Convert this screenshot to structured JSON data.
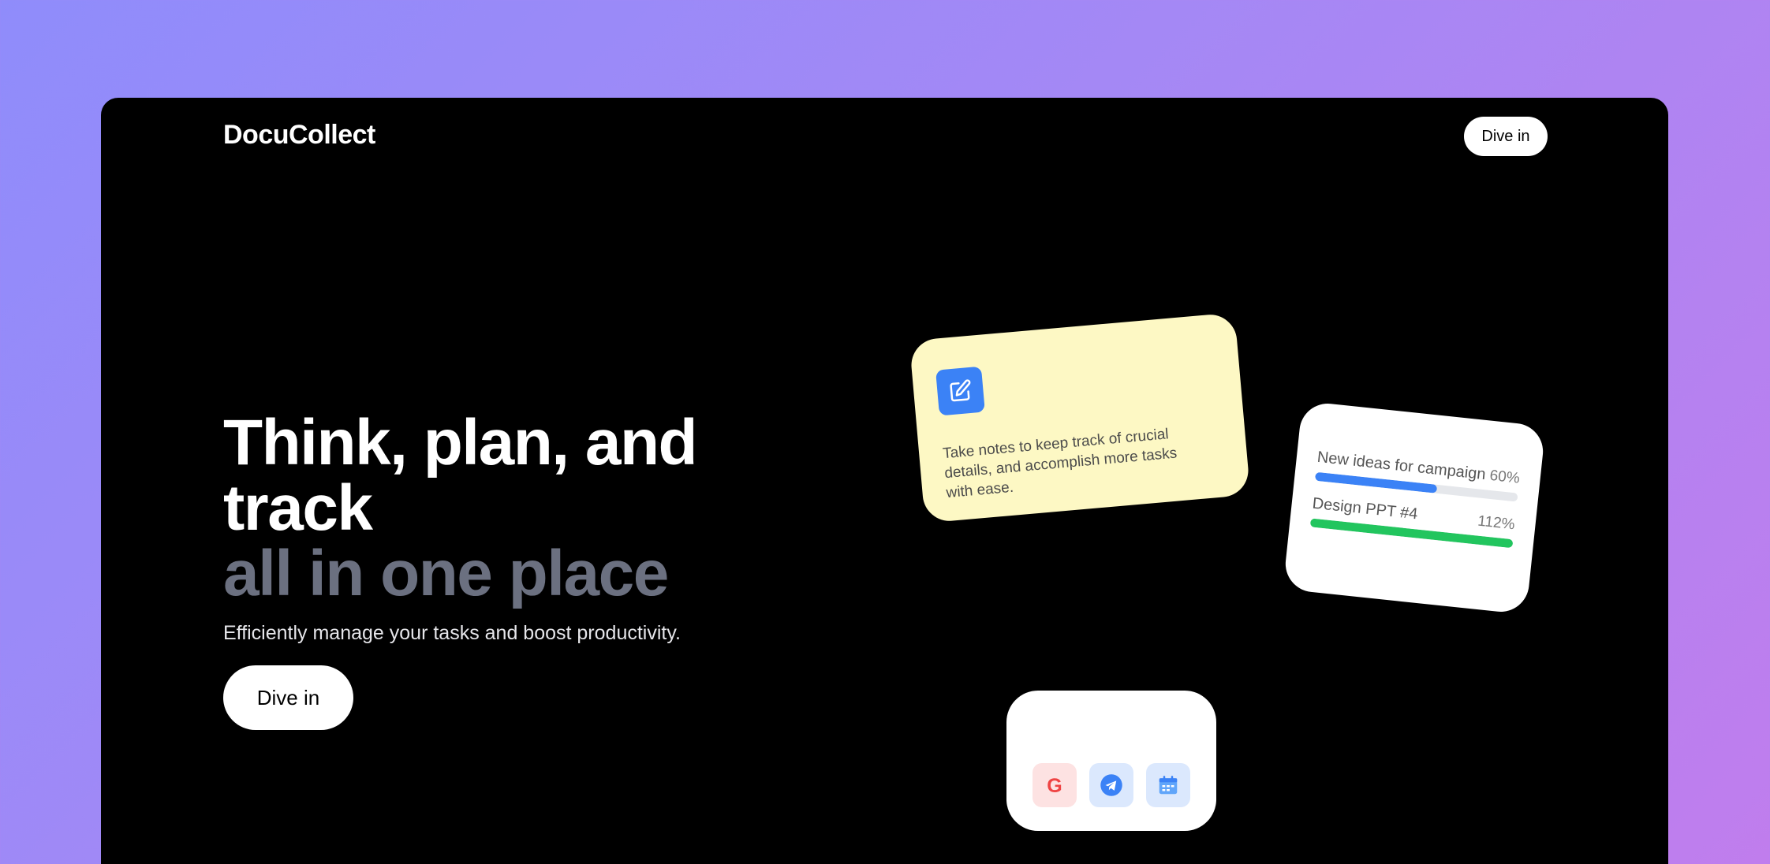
{
  "brand": {
    "name": "DocuCollect"
  },
  "nav": {
    "cta_label": "Dive in"
  },
  "hero": {
    "line1": "Think, plan, and",
    "line2": "track",
    "line3": "all in one place",
    "subtitle": "Efficiently manage your tasks and boost productivity.",
    "cta_label": "Dive in"
  },
  "note_card": {
    "icon": "edit-icon",
    "text": "Take notes to keep track of crucial details, and accomplish more tasks with ease."
  },
  "progress_card": {
    "items": [
      {
        "label": "New ideas for campaign",
        "percent_label": "60%",
        "progress": 0.6,
        "color": "#3b82f6"
      },
      {
        "label": "Design PPT #4",
        "percent_label": "112%",
        "progress": 1.0,
        "color": "#22c55e"
      }
    ]
  },
  "apps_card": {
    "apps": [
      {
        "icon": "google-icon",
        "color": "#ef4444"
      },
      {
        "icon": "telegram-icon",
        "color": "#3b82f6"
      },
      {
        "icon": "calendar-icon",
        "color": "#60a5fa"
      }
    ]
  },
  "colors": {
    "accent_blue": "#3b82f6",
    "accent_green": "#22c55e",
    "note_bg": "#fdf8c4",
    "hero_gray": "#6b7080"
  }
}
